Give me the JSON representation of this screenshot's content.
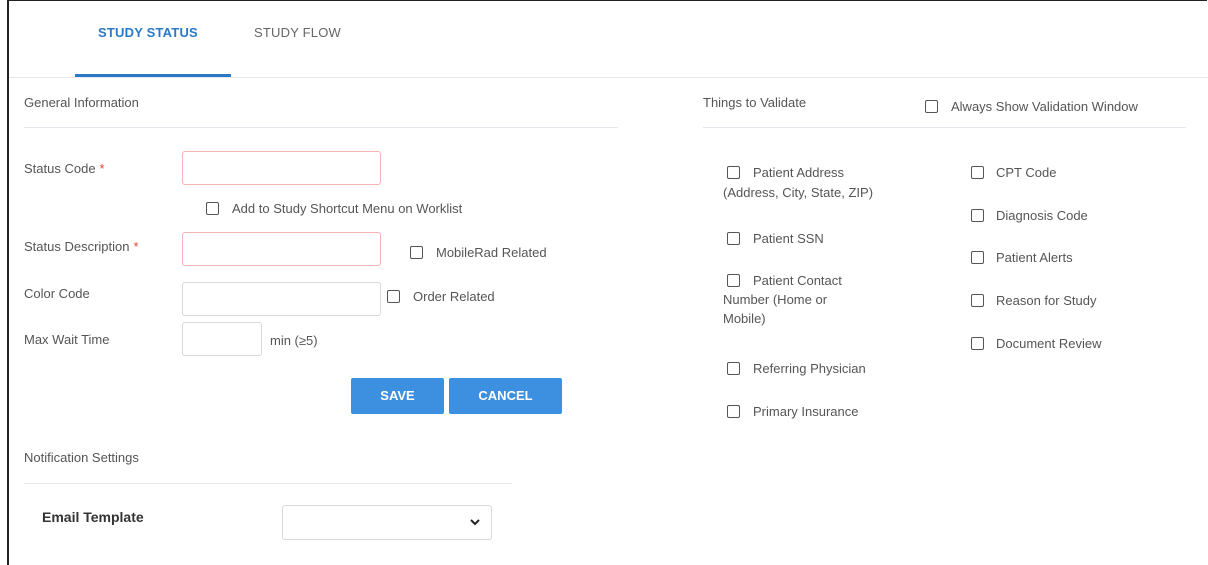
{
  "tabs": [
    {
      "label": "STUDY STATUS",
      "active": true
    },
    {
      "label": "STUDY FLOW",
      "active": false
    }
  ],
  "general": {
    "title": "General Information",
    "status_code_label": "Status Code",
    "required_marker": "*",
    "status_code_value": "",
    "shortcut_checkbox_label": "Add to Study Shortcut Menu on Worklist",
    "status_description_label": "Status Description",
    "status_description_value": "",
    "mobilerad_label": "MobileRad Related",
    "color_code_label": "Color Code",
    "color_code_value": "",
    "order_related_label": "Order Related",
    "max_wait_label": "Max Wait Time",
    "max_wait_value": "",
    "max_wait_unit": "min (≥5)"
  },
  "actions": {
    "save_label": "SAVE",
    "cancel_label": "CANCEL"
  },
  "notification": {
    "title": "Notification Settings",
    "email_template_label": "Email Template",
    "email_template_value": ""
  },
  "validate": {
    "title": "Things to Validate",
    "always_show_label": "Always Show Validation Window",
    "left_items": [
      {
        "line1": "Patient Address",
        "line2": "(Address, City, State, ZIP)"
      },
      {
        "line1": "Patient SSN"
      },
      {
        "line1": "Patient Contact",
        "line2": "Number (Home or",
        "line3": "Mobile)"
      },
      {
        "line1": "Referring Physician"
      },
      {
        "line1": "Primary Insurance"
      }
    ],
    "right_items": [
      "CPT Code",
      "Diagnosis Code",
      "Patient Alerts",
      "Reason for Study",
      "Document Review"
    ]
  },
  "colors": {
    "accent": "#2a78c8",
    "button": "#3d8fe0",
    "required": "#e0443a"
  }
}
